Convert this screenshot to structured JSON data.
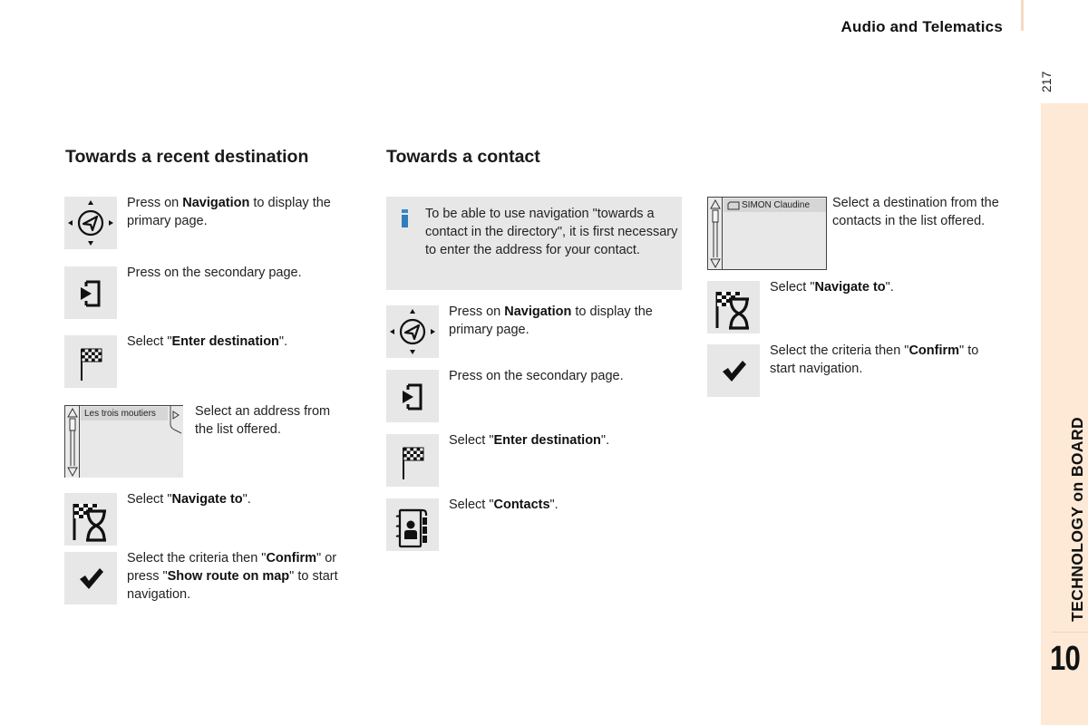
{
  "header": {
    "title": "Audio and Telematics",
    "page_number": "217"
  },
  "sidebar": {
    "label": "TECHNOLOGY on BOARD",
    "chapter": "10",
    "color": "#fde9d6"
  },
  "recent": {
    "title": "Towards a recent destination",
    "steps": [
      {
        "icon": "navigation-icon",
        "pre": "Press on ",
        "bold": "Navigation",
        "post": " to display the primary page."
      },
      {
        "icon": "secondary-page-icon",
        "pre": "Press on the secondary page.",
        "bold": "",
        "post": ""
      },
      {
        "icon": "checkered-flag-icon",
        "pre": "Select \"",
        "bold": "Enter destination",
        "post": "\"."
      },
      {
        "icon": "address-list-screen",
        "pre": "Select an address from the list offered.",
        "bold": "",
        "post": ""
      },
      {
        "icon": "navigate-to-icon",
        "pre": "Select \"",
        "bold": "Navigate to",
        "post": "\"."
      },
      {
        "icon": "checkmark-icon",
        "pre": "Select the criteria then \"",
        "bold": "Confirm",
        "mid": "\" or press \"",
        "bold2": "Show route on map",
        "post": "\" to start navigation."
      }
    ],
    "list_screen_item": "Les trois moutiers"
  },
  "contact": {
    "title": "Towards a contact",
    "info": {
      "icon": "info-icon",
      "text": "To be able to use navigation \"towards a contact in the directory\", it is first necessary to enter the address for your contact.",
      "accent": "#2f7dbd"
    },
    "steps": [
      {
        "icon": "navigation-icon",
        "pre": "Press on ",
        "bold": "Navigation",
        "post": " to display the primary page."
      },
      {
        "icon": "secondary-page-icon",
        "pre": "Press on the secondary page.",
        "bold": "",
        "post": ""
      },
      {
        "icon": "checkered-flag-icon",
        "pre": "Select \"",
        "bold": "Enter destination",
        "post": "\"."
      },
      {
        "icon": "contacts-icon",
        "pre": "Select \"",
        "bold": "Contacts",
        "post": "\"."
      }
    ],
    "steps_right": [
      {
        "icon": "contact-list-screen",
        "pre": "Select a destination from the contacts in the list offered.",
        "bold": "",
        "post": ""
      },
      {
        "icon": "navigate-to-icon",
        "pre": "Select \"",
        "bold": "Navigate to",
        "post": "\"."
      },
      {
        "icon": "checkmark-icon",
        "pre": "Select the criteria then \"",
        "bold": "Confirm",
        "post": "\" to start navigation."
      }
    ],
    "list_screen_item": "SIMON Claudine"
  }
}
